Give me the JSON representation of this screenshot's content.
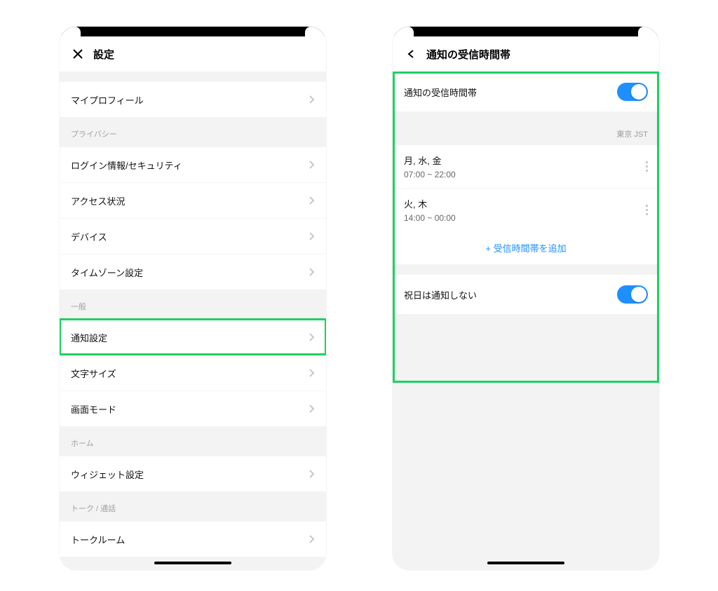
{
  "left": {
    "header": {
      "title": "設定"
    },
    "sections": [
      {
        "kind": "gap"
      },
      {
        "kind": "rows",
        "items": [
          {
            "label": "マイプロフィール"
          }
        ]
      },
      {
        "kind": "label",
        "text": "プライバシー"
      },
      {
        "kind": "rows",
        "items": [
          {
            "label": "ログイン情報/セキュリティ"
          },
          {
            "label": "アクセス状況"
          },
          {
            "label": "デバイス"
          },
          {
            "label": "タイムゾーン設定"
          }
        ]
      },
      {
        "kind": "label",
        "text": "一般"
      },
      {
        "kind": "rows",
        "items": [
          {
            "label": "通知設定",
            "highlight": true
          },
          {
            "label": "文字サイズ"
          },
          {
            "label": "画面モード"
          }
        ]
      },
      {
        "kind": "label",
        "text": "ホーム"
      },
      {
        "kind": "rows",
        "items": [
          {
            "label": "ウィジェット設定"
          }
        ]
      },
      {
        "kind": "label",
        "text": "トーク / 通話"
      },
      {
        "kind": "rows",
        "items": [
          {
            "label": "トークルーム"
          }
        ]
      }
    ]
  },
  "right": {
    "header": {
      "title": "通知の受信時間帯"
    },
    "toggle_row": {
      "label": "通知の受信時間帯",
      "on": true
    },
    "timezone_note": "東京 JST",
    "schedules": [
      {
        "days": "月, 水, 金",
        "time": "07:00 ~ 22:00"
      },
      {
        "days": "火, 木",
        "time": "14:00 ~ 00:00"
      }
    ],
    "add_label": "+ 受信時間帯を追加",
    "holiday_row": {
      "label": "祝日は通知しない",
      "on": true
    }
  }
}
